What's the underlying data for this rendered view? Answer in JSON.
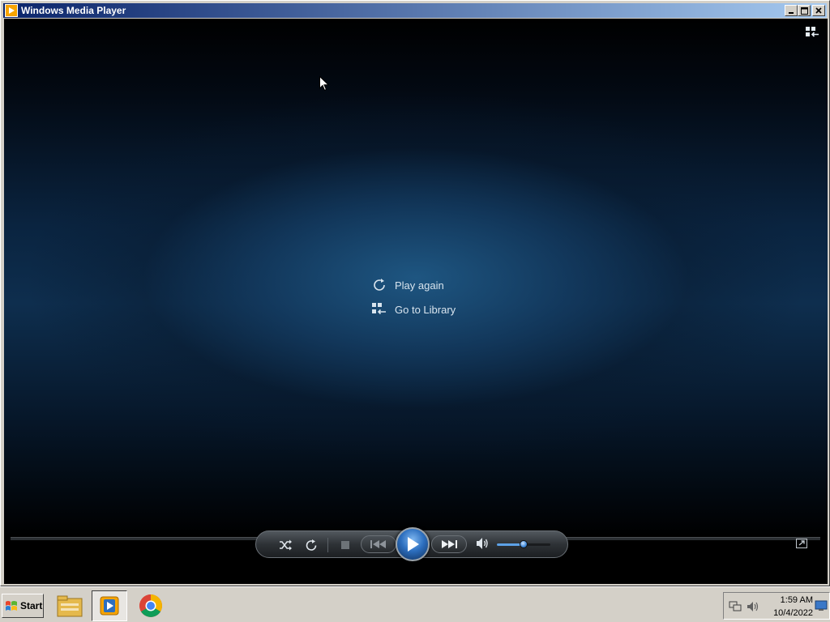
{
  "window": {
    "title": "Windows Media Player",
    "buttons": {
      "minimize": "_",
      "maximize": "□",
      "close": "✕"
    }
  },
  "player": {
    "end_menu": [
      {
        "icon": "replay-icon",
        "label": "Play again"
      },
      {
        "icon": "library-icon",
        "label": "Go to Library"
      }
    ],
    "volume_level": 0.5,
    "accent_color": "#2d6fbf"
  },
  "transport": [
    "shuffle-icon",
    "repeat-icon",
    "stop-icon",
    "previous-icon",
    "play-icon",
    "next-icon",
    "volume-icon"
  ],
  "taskbar": {
    "start_label": "Start",
    "apps": [
      "file-explorer-icon",
      "windows-media-player-icon",
      "chrome-icon"
    ],
    "clock": {
      "time": "1:59 AM",
      "date": "10/4/2022"
    }
  }
}
